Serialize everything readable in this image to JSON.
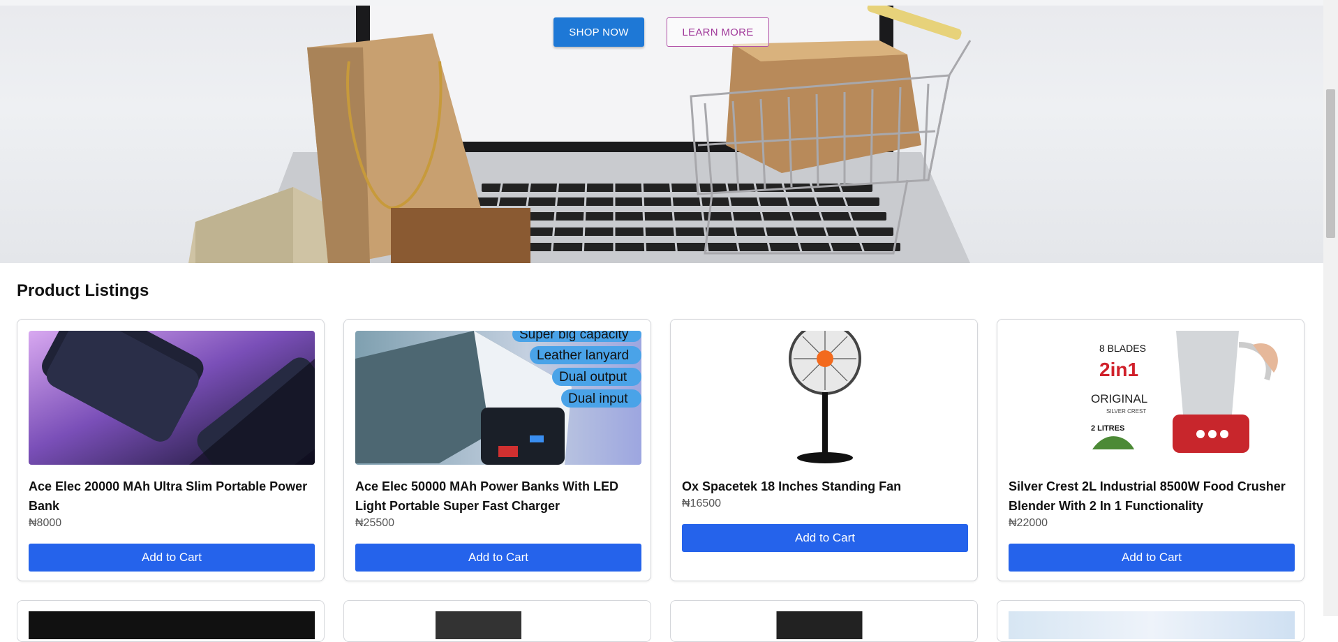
{
  "hero": {
    "shop_label": "SHOP NOW",
    "learn_label": "LEARN MORE",
    "image_alt": "Shopping cart with boxes and bags on laptop keyboard"
  },
  "listings": {
    "title": "Product Listings",
    "currency": "₦",
    "cart_label": "Add to Cart",
    "products": [
      {
        "name": "Ace Elec 20000 MAh Ultra Slim Portable Power Bank",
        "price": "₦8000"
      },
      {
        "name": "Ace Elec 50000 MAh Power Banks With LED Light Portable Super Fast Charger",
        "price": "₦25500",
        "image_text": [
          "Super big capacity",
          "Leather lanyard",
          "Dual output",
          "Dual input"
        ]
      },
      {
        "name": "Ox Spacetek 18 Inches Standing Fan",
        "price": "₦16500"
      },
      {
        "name": "Silver Crest 2L Industrial 8500W Food Crusher Blender With 2 In 1 Functionality",
        "price": "₦22000",
        "image_text": [
          "8 BLADES",
          "2in1",
          "ORIGINAL",
          "SILVER CREST",
          "2 LITRES"
        ]
      }
    ]
  },
  "colors": {
    "primary": "#2563eb",
    "shop_button": "#1e78d6",
    "learn_border": "#b04fa6"
  }
}
